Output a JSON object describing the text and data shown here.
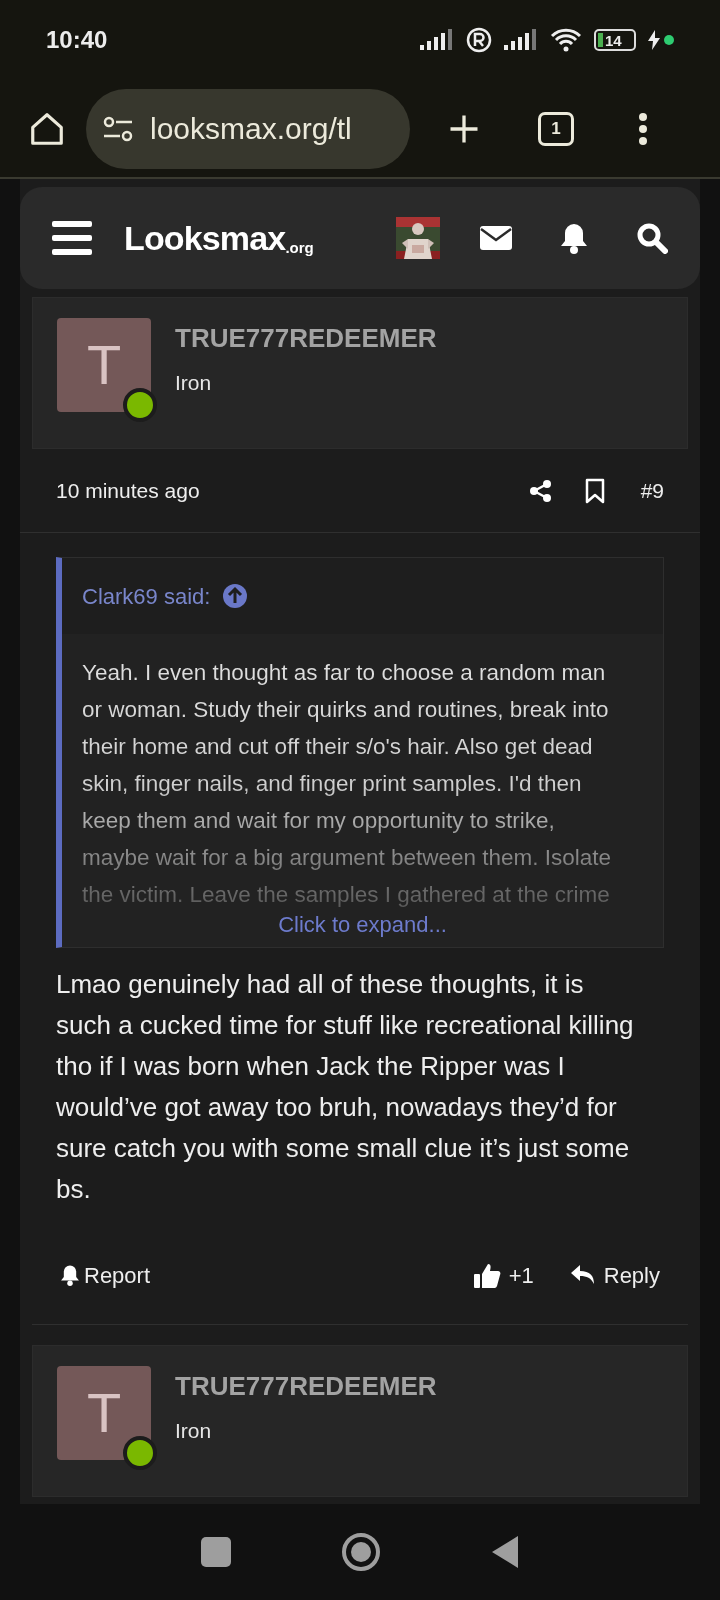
{
  "status_bar": {
    "time": "10:40",
    "battery": "14"
  },
  "browser": {
    "url": "looksmax.org/tl",
    "tab_count": "1"
  },
  "site_header": {
    "logo": "Looksmax",
    "logo_suffix": ".org"
  },
  "posts": [
    {
      "author": "TRUE777REDEEMER",
      "avatar_letter": "T",
      "rank": "Iron",
      "online": true,
      "time": "10 minutes ago",
      "number": "#9",
      "quote": {
        "author": "Clark69 said:",
        "text": "Yeah. I even thought as far to choose a random man or woman. Study their quirks and routines, break into their home and cut off their s/o's hair. Also get dead skin, finger nails, and finger print samples. I'd then keep them and wait for my opportunity to strike, maybe wait for a big argument between them. Isolate the victim. Leave the samples I gathered at the crime",
        "expand": "Click to expand..."
      },
      "body": "Lmao genuinely had all of these thoughts, it is such a cucked time for stuff like recreational killing tho if I was born when Jack the Ripper was I would’ve got away too bruh, nowadays they’d for sure catch you with some small clue it’s just some bs.",
      "report": "Report",
      "likes": "+1",
      "reply": "Reply"
    }
  ],
  "next_post": {
    "author": "TRUE777REDEEMER",
    "avatar_letter": "T",
    "rank": "Iron",
    "online": true
  }
}
